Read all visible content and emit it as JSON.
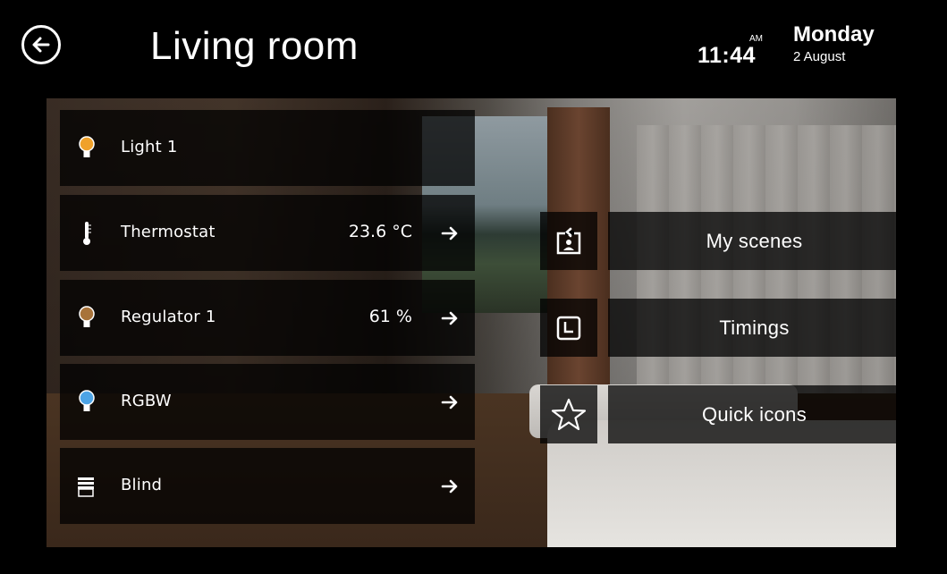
{
  "header": {
    "title": "Living room",
    "ampm": "AM",
    "time": "11:44",
    "weekday": "Monday",
    "date": "2 August",
    "back_icon": "arrow-left-circle-icon"
  },
  "devices": [
    {
      "label": "Light 1",
      "value": "",
      "icon": "bulb-icon",
      "icon_color": "#f0a12a",
      "arrow": false
    },
    {
      "label": "Thermostat",
      "value": "23.6 °C",
      "icon": "thermometer-icon",
      "icon_color": "#ffffff",
      "arrow": true
    },
    {
      "label": "Regulator 1",
      "value": "61 %",
      "icon": "bulb-icon",
      "icon_color": "#a8733a",
      "arrow": true
    },
    {
      "label": "RGBW",
      "value": "",
      "icon": "bulb-icon",
      "icon_color": "#4da4e6",
      "arrow": true
    },
    {
      "label": "Blind",
      "value": "",
      "icon": "blind-icon",
      "icon_color": "#ffffff",
      "arrow": true
    }
  ],
  "actions": [
    {
      "label": "My scenes",
      "icon": "scene-icon"
    },
    {
      "label": "Timings",
      "icon": "clock-icon"
    },
    {
      "label": "Quick icons",
      "icon": "star-icon"
    }
  ],
  "colors": {
    "background": "#000000",
    "panel": "rgba(0,0,0,0.74)",
    "text": "#ffffff"
  }
}
